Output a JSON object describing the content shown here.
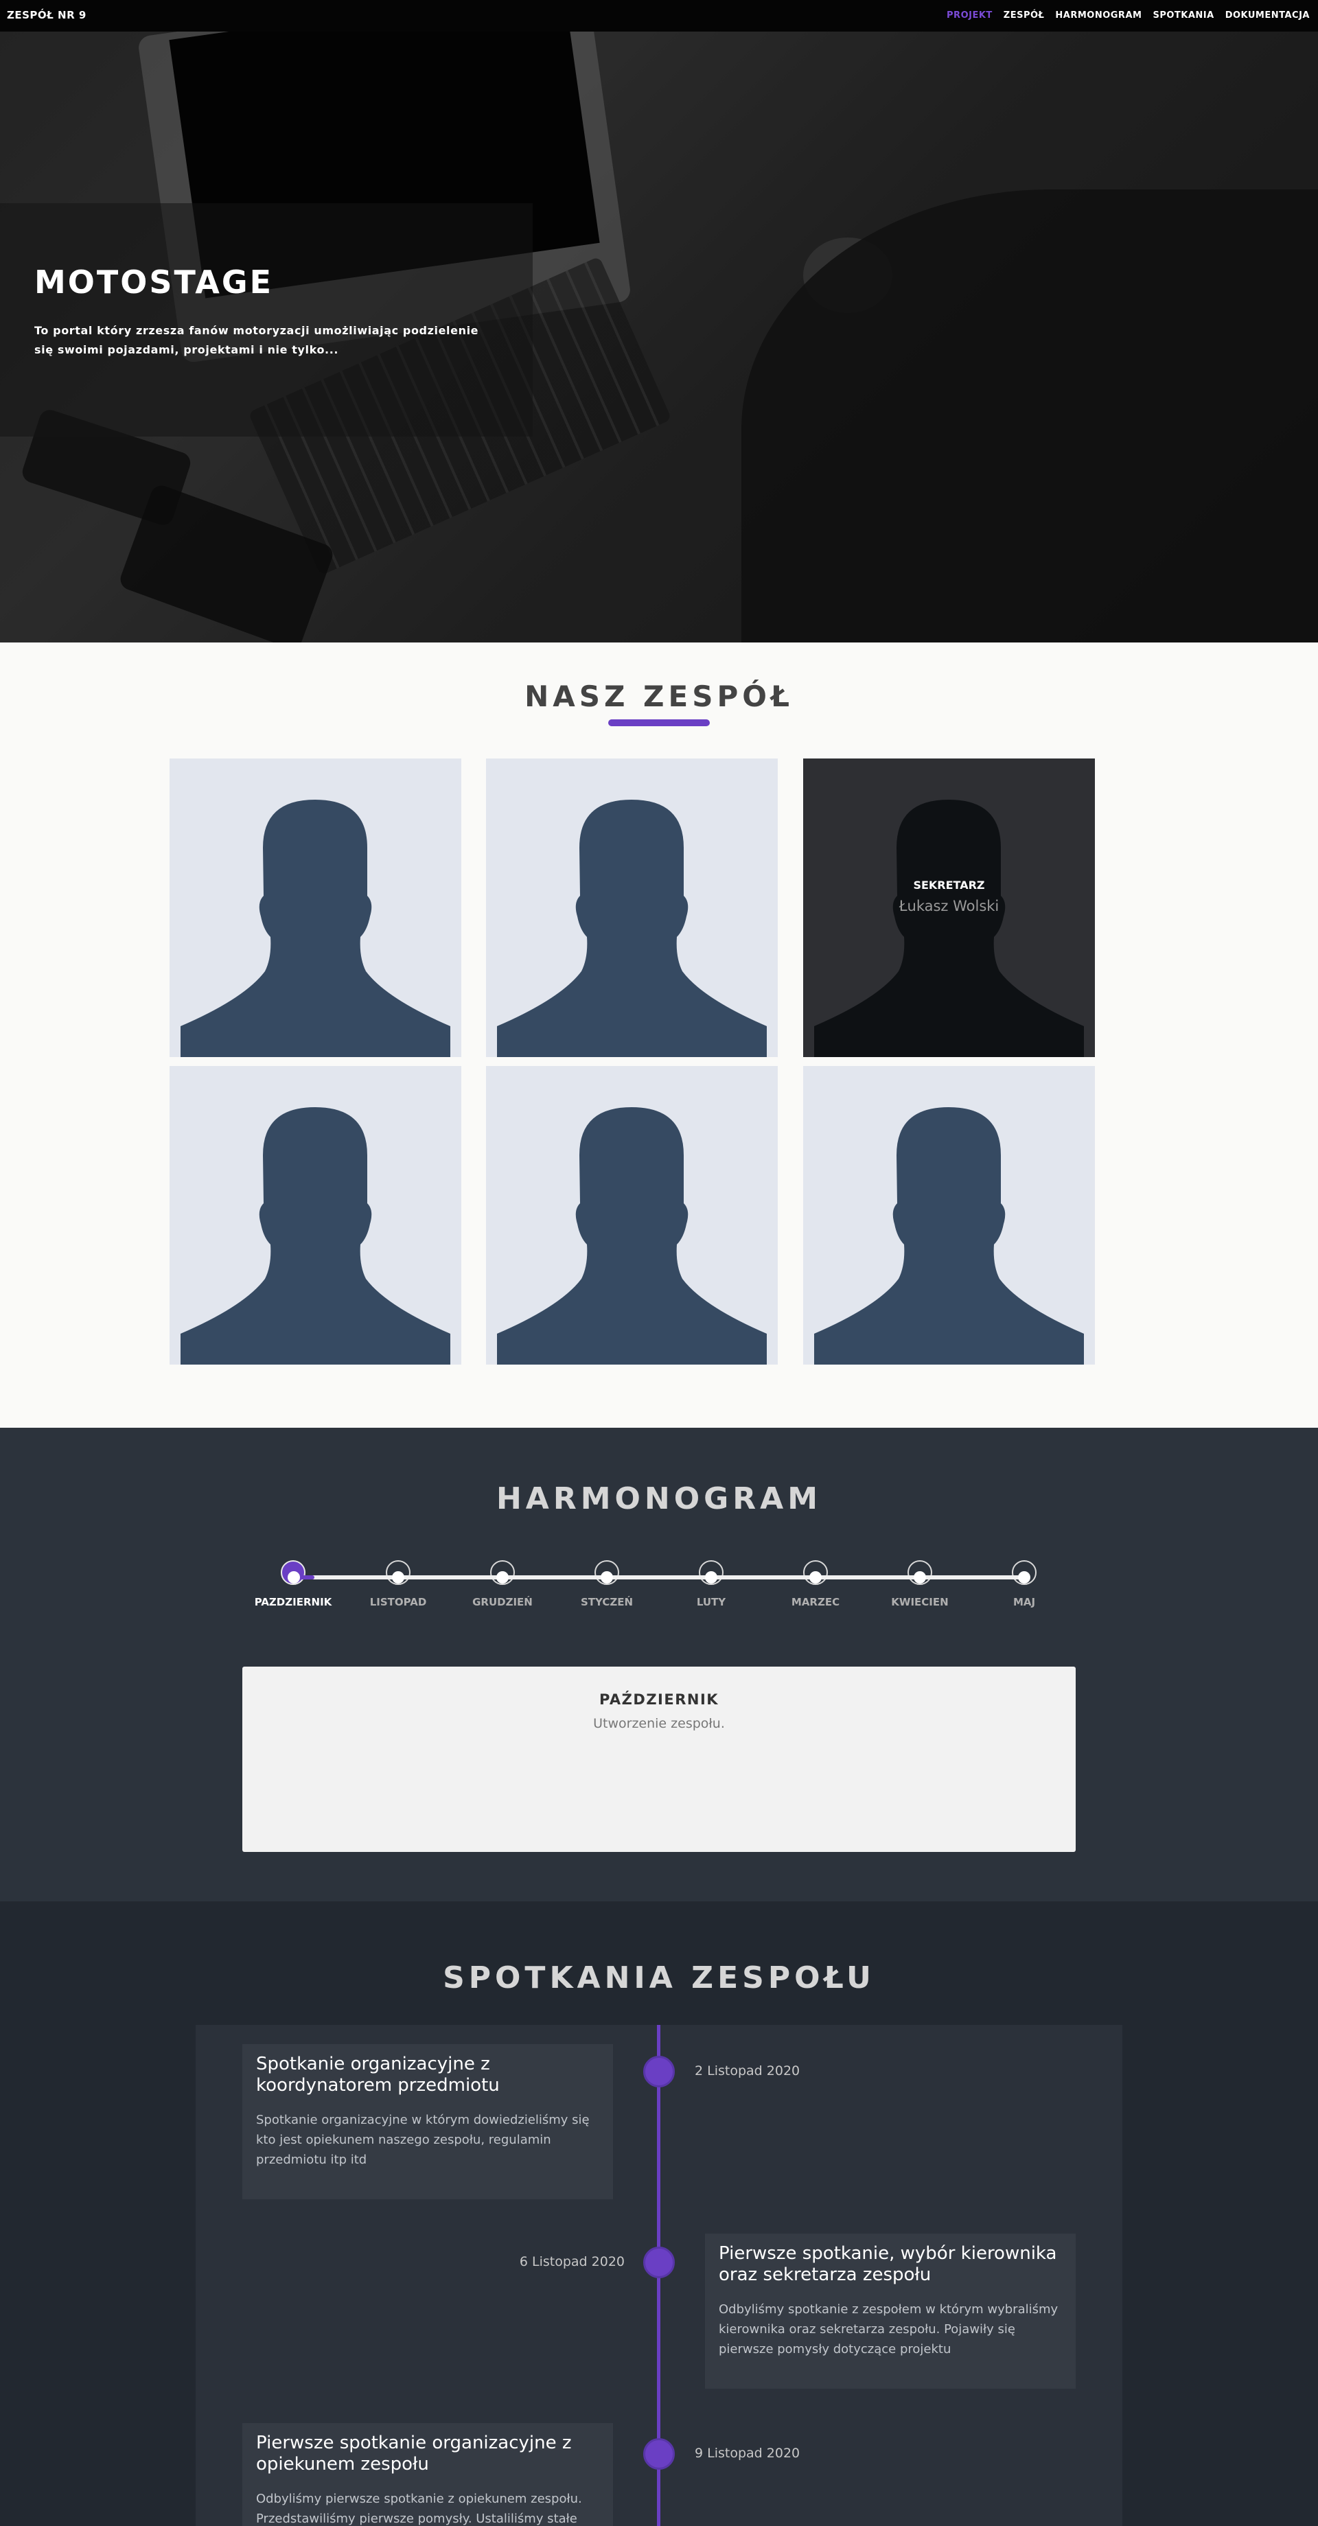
{
  "nav": {
    "brand": "ZESPÓŁ NR 9",
    "items": [
      "PROJEKT",
      "ZESPÓŁ",
      "HARMONOGRAM",
      "SPOTKANIA",
      "DOKUMENTACJA"
    ],
    "active": "PROJEKT",
    "accent": "#7b4bd6"
  },
  "hero": {
    "title": "MOTOSTAGE",
    "subtitle": "To portal który zrzesza fanów motoryzacji umożliwiając podzielenie się swoimi pojazdami, projektami i nie tylko..."
  },
  "team": {
    "title": "NASZ ZESPÓŁ",
    "hover_card": {
      "role": "SEKRETARZ",
      "name": "Łukasz Wolski"
    },
    "avatar_icon": "person-silhouette-icon"
  },
  "harmonogram": {
    "title": "HARMONOGRAM",
    "months": [
      "PAZDZIERNIK",
      "LISTOPAD",
      "GRUDZIEŃ",
      "STYCZEŃ",
      "LUTY",
      "MARZEC",
      "KWIECIEN",
      "MAJ"
    ],
    "active_index": 0,
    "panel_title": "PAŹDZIERNIK",
    "panel_text": "Utworzenie zespołu."
  },
  "meetings": {
    "title": "SPOTKANIA ZESPOŁU",
    "items": [
      {
        "title": "Spotkanie organizacyjne z koordynatorem przedmiotu",
        "text": "Spotkanie organizacyjne w którym dowiedzieliśmy się kto jest opiekunem naszego zespołu, regulamin przedmiotu itp itd",
        "date": "2 Listopad 2020"
      },
      {
        "title": "Pierwsze spotkanie, wybór kierownika oraz sekretarza zespołu",
        "text": "Odbyliśmy spotkanie z zespołem w którym wybraliśmy kierownika oraz sekretarza zespołu. Pojawiły się pierwsze pomysły dotyczące projektu",
        "date": "6 Listopad 2020"
      },
      {
        "title": "Pierwsze spotkanie organizacyjne z opiekunem zespołu",
        "text": "Odbyliśmy pierwsze spotkanie z opiekunem zespołu. Przedstawiliśmy pierwsze pomysły. Ustaliliśmy stałe",
        "date": "9 Listopad 2020"
      }
    ]
  }
}
